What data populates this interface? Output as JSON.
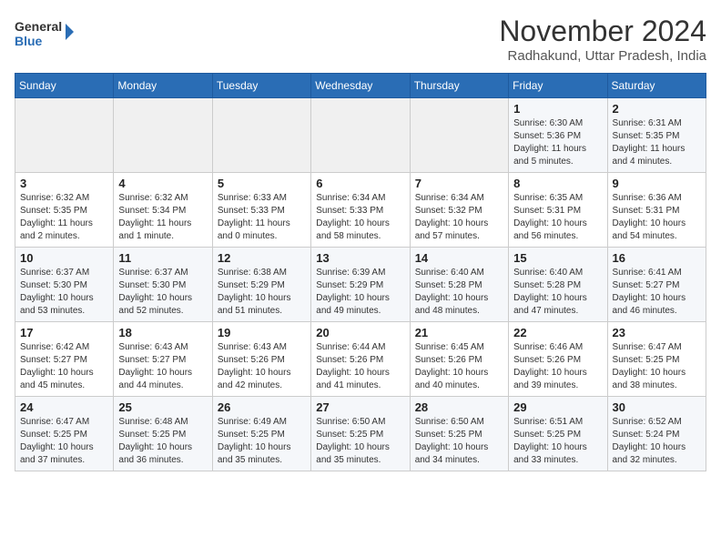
{
  "header": {
    "logo_line1": "General",
    "logo_line2": "Blue",
    "month": "November 2024",
    "location": "Radhakund, Uttar Pradesh, India"
  },
  "weekdays": [
    "Sunday",
    "Monday",
    "Tuesday",
    "Wednesday",
    "Thursday",
    "Friday",
    "Saturday"
  ],
  "weeks": [
    [
      {
        "day": "",
        "info": ""
      },
      {
        "day": "",
        "info": ""
      },
      {
        "day": "",
        "info": ""
      },
      {
        "day": "",
        "info": ""
      },
      {
        "day": "",
        "info": ""
      },
      {
        "day": "1",
        "info": "Sunrise: 6:30 AM\nSunset: 5:36 PM\nDaylight: 11 hours and 5 minutes."
      },
      {
        "day": "2",
        "info": "Sunrise: 6:31 AM\nSunset: 5:35 PM\nDaylight: 11 hours and 4 minutes."
      }
    ],
    [
      {
        "day": "3",
        "info": "Sunrise: 6:32 AM\nSunset: 5:35 PM\nDaylight: 11 hours and 2 minutes."
      },
      {
        "day": "4",
        "info": "Sunrise: 6:32 AM\nSunset: 5:34 PM\nDaylight: 11 hours and 1 minute."
      },
      {
        "day": "5",
        "info": "Sunrise: 6:33 AM\nSunset: 5:33 PM\nDaylight: 11 hours and 0 minutes."
      },
      {
        "day": "6",
        "info": "Sunrise: 6:34 AM\nSunset: 5:33 PM\nDaylight: 10 hours and 58 minutes."
      },
      {
        "day": "7",
        "info": "Sunrise: 6:34 AM\nSunset: 5:32 PM\nDaylight: 10 hours and 57 minutes."
      },
      {
        "day": "8",
        "info": "Sunrise: 6:35 AM\nSunset: 5:31 PM\nDaylight: 10 hours and 56 minutes."
      },
      {
        "day": "9",
        "info": "Sunrise: 6:36 AM\nSunset: 5:31 PM\nDaylight: 10 hours and 54 minutes."
      }
    ],
    [
      {
        "day": "10",
        "info": "Sunrise: 6:37 AM\nSunset: 5:30 PM\nDaylight: 10 hours and 53 minutes."
      },
      {
        "day": "11",
        "info": "Sunrise: 6:37 AM\nSunset: 5:30 PM\nDaylight: 10 hours and 52 minutes."
      },
      {
        "day": "12",
        "info": "Sunrise: 6:38 AM\nSunset: 5:29 PM\nDaylight: 10 hours and 51 minutes."
      },
      {
        "day": "13",
        "info": "Sunrise: 6:39 AM\nSunset: 5:29 PM\nDaylight: 10 hours and 49 minutes."
      },
      {
        "day": "14",
        "info": "Sunrise: 6:40 AM\nSunset: 5:28 PM\nDaylight: 10 hours and 48 minutes."
      },
      {
        "day": "15",
        "info": "Sunrise: 6:40 AM\nSunset: 5:28 PM\nDaylight: 10 hours and 47 minutes."
      },
      {
        "day": "16",
        "info": "Sunrise: 6:41 AM\nSunset: 5:27 PM\nDaylight: 10 hours and 46 minutes."
      }
    ],
    [
      {
        "day": "17",
        "info": "Sunrise: 6:42 AM\nSunset: 5:27 PM\nDaylight: 10 hours and 45 minutes."
      },
      {
        "day": "18",
        "info": "Sunrise: 6:43 AM\nSunset: 5:27 PM\nDaylight: 10 hours and 44 minutes."
      },
      {
        "day": "19",
        "info": "Sunrise: 6:43 AM\nSunset: 5:26 PM\nDaylight: 10 hours and 42 minutes."
      },
      {
        "day": "20",
        "info": "Sunrise: 6:44 AM\nSunset: 5:26 PM\nDaylight: 10 hours and 41 minutes."
      },
      {
        "day": "21",
        "info": "Sunrise: 6:45 AM\nSunset: 5:26 PM\nDaylight: 10 hours and 40 minutes."
      },
      {
        "day": "22",
        "info": "Sunrise: 6:46 AM\nSunset: 5:26 PM\nDaylight: 10 hours and 39 minutes."
      },
      {
        "day": "23",
        "info": "Sunrise: 6:47 AM\nSunset: 5:25 PM\nDaylight: 10 hours and 38 minutes."
      }
    ],
    [
      {
        "day": "24",
        "info": "Sunrise: 6:47 AM\nSunset: 5:25 PM\nDaylight: 10 hours and 37 minutes."
      },
      {
        "day": "25",
        "info": "Sunrise: 6:48 AM\nSunset: 5:25 PM\nDaylight: 10 hours and 36 minutes."
      },
      {
        "day": "26",
        "info": "Sunrise: 6:49 AM\nSunset: 5:25 PM\nDaylight: 10 hours and 35 minutes."
      },
      {
        "day": "27",
        "info": "Sunrise: 6:50 AM\nSunset: 5:25 PM\nDaylight: 10 hours and 35 minutes."
      },
      {
        "day": "28",
        "info": "Sunrise: 6:50 AM\nSunset: 5:25 PM\nDaylight: 10 hours and 34 minutes."
      },
      {
        "day": "29",
        "info": "Sunrise: 6:51 AM\nSunset: 5:25 PM\nDaylight: 10 hours and 33 minutes."
      },
      {
        "day": "30",
        "info": "Sunrise: 6:52 AM\nSunset: 5:24 PM\nDaylight: 10 hours and 32 minutes."
      }
    ]
  ]
}
